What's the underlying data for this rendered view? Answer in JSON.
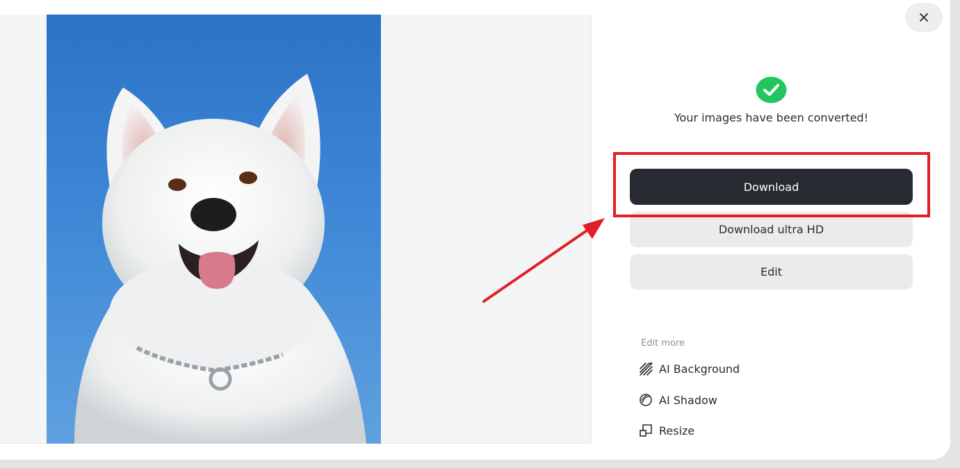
{
  "dialog": {
    "close_label": "×"
  },
  "result": {
    "status_text": "Your images have been converted!",
    "status_icon": "check-circle-icon",
    "success_color": "#22c55e"
  },
  "actions": {
    "download_label": "Download",
    "download_uhd_label": "Download ultra HD",
    "edit_label": "Edit"
  },
  "edit_more": {
    "heading": "Edit more",
    "items": [
      {
        "label": "AI Background",
        "icon": "ai-background-icon"
      },
      {
        "label": "AI Shadow",
        "icon": "ai-shadow-icon"
      },
      {
        "label": "Resize",
        "icon": "resize-icon"
      }
    ]
  },
  "preview": {
    "subject": "white-dog-photo"
  },
  "annotation": {
    "color": "#e11f26"
  }
}
